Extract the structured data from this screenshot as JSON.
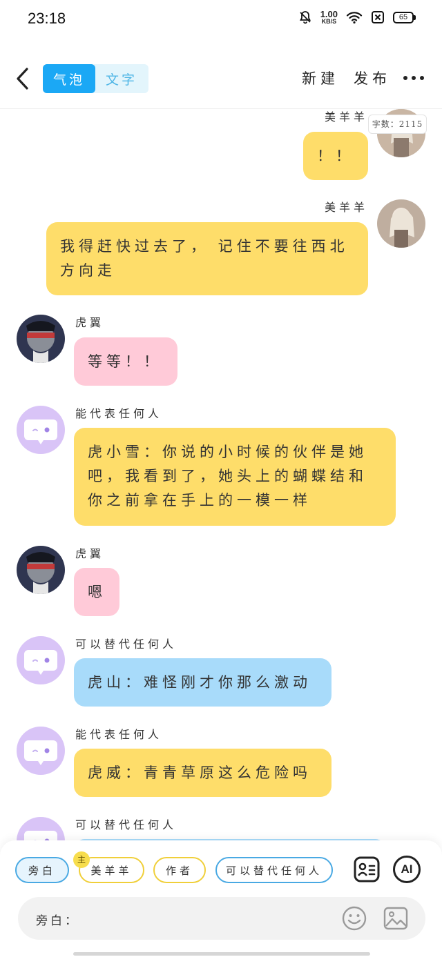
{
  "status_bar": {
    "time": "23:18",
    "net_speed_value": "1.00",
    "net_speed_unit": "KB/S",
    "battery": "65"
  },
  "top_nav": {
    "tabs": [
      {
        "label": "气泡",
        "active": true
      },
      {
        "label": "文字",
        "active": false
      }
    ],
    "new_label": "新建",
    "publish_label": "发布"
  },
  "chat": {
    "word_count": "字数：2115",
    "messages": [
      {
        "sender": "美羊羊",
        "text": "！！",
        "side": "right",
        "color": "yellow"
      },
      {
        "sender": "美羊羊",
        "text": "我得赶快过去了， 记住不要往西北方向走",
        "side": "right",
        "color": "yellow"
      },
      {
        "sender": "虎翼",
        "text": "等等！！",
        "side": "left",
        "color": "pink"
      },
      {
        "sender": "能代表任何人",
        "text": "虎小雪：你说的小时候的伙伴是她吧，我看到了，她头上的蝴蝶结和你之前拿在手上的一模一样",
        "side": "left",
        "color": "yellow"
      },
      {
        "sender": "虎翼",
        "text": "嗯",
        "side": "left",
        "color": "pink"
      },
      {
        "sender": "可以替代任何人",
        "text": "虎山：难怪刚才你那么激动",
        "side": "left",
        "color": "blue"
      },
      {
        "sender": "能代表任何人",
        "text": "虎威：青青草原这么危险吗",
        "side": "left",
        "color": "yellow"
      },
      {
        "sender": "可以替代任何人",
        "text": "",
        "side": "left",
        "color": "blue"
      }
    ]
  },
  "bottom_panel": {
    "roles": [
      "旁白",
      "美羊羊",
      "作者",
      "可以替代任何人"
    ],
    "selected_role": "旁白",
    "host_badge": "主",
    "ai_label": "AI",
    "input_label": "旁白：",
    "input_value": ""
  },
  "colors": {
    "accent": "#1ba8f5",
    "bubble_yellow": "#fedd6a",
    "bubble_pink": "#ffcad8",
    "bubble_blue": "#a8dbfa"
  }
}
